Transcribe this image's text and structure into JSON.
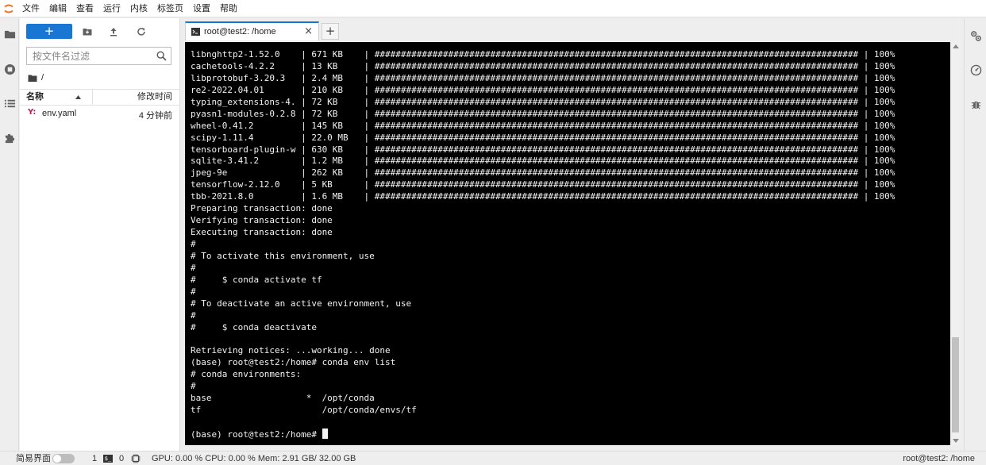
{
  "menu": [
    "文件",
    "编辑",
    "查看",
    "运行",
    "内核",
    "标签页",
    "设置",
    "帮助"
  ],
  "file_browser": {
    "new_button_label": "+",
    "search_placeholder": "按文件名过滤",
    "breadcrumb_path": "/",
    "columns": {
      "name": "名称",
      "modified": "修改时间"
    },
    "files": [
      {
        "icon": "Y:",
        "name": "env.yaml",
        "modified": "4 分钟前"
      }
    ]
  },
  "tab": {
    "label": "root@test2: /home",
    "close_glyph": "×",
    "add_glyph": "+"
  },
  "terminal": {
    "lines": [
      "libnghttp2-1.52.0    | 671 KB    | ############################################################################################ | 100%",
      "cachetools-4.2.2     | 13 KB     | ############################################################################################ | 100%",
      "libprotobuf-3.20.3   | 2.4 MB    | ############################################################################################ | 100%",
      "re2-2022.04.01       | 210 KB    | ############################################################################################ | 100%",
      "typing_extensions-4. | 72 KB     | ############################################################################################ | 100%",
      "pyasn1-modules-0.2.8 | 72 KB     | ############################################################################################ | 100%",
      "wheel-0.41.2         | 145 KB    | ############################################################################################ | 100%",
      "scipy-1.11.4         | 22.0 MB   | ############################################################################################ | 100%",
      "tensorboard-plugin-w | 630 KB    | ############################################################################################ | 100%",
      "sqlite-3.41.2        | 1.2 MB    | ############################################################################################ | 100%",
      "jpeg-9e              | 262 KB    | ############################################################################################ | 100%",
      "tensorflow-2.12.0    | 5 KB      | ############################################################################################ | 100%",
      "tbb-2021.8.0         | 1.6 MB    | ############################################################################################ | 100%",
      "Preparing transaction: done",
      "Verifying transaction: done",
      "Executing transaction: done",
      "#",
      "# To activate this environment, use",
      "#",
      "#     $ conda activate tf",
      "#",
      "# To deactivate an active environment, use",
      "#",
      "#     $ conda deactivate",
      "",
      "Retrieving notices: ...working... done",
      "(base) root@test2:/home# conda env list",
      "# conda environments:",
      "#",
      "base                  *  /opt/conda",
      "tf                       /opt/conda/envs/tf",
      "",
      "(base) root@test2:/home# "
    ]
  },
  "status": {
    "simple_mode_label": "简易界面",
    "terminal_count": "1",
    "terminal_icon_glyph": "$_",
    "kernel_count": "0",
    "resources": "GPU: 0.00 % CPU: 0.00 % Mem: 2.91 GB/ 32.00 GB",
    "right_text": "root@test2: /home"
  },
  "icons": {
    "logo": "jupyter-logo-icon",
    "activity": [
      "folder-icon",
      "running-stop-icon",
      "table-of-contents-icon",
      "extension-puzzle-icon"
    ],
    "right": [
      "property-inspector-gears-icon",
      "debugger-gauge-icon",
      "bug-icon"
    ]
  },
  "colors": {
    "accent": "#1976d2",
    "terminal_bg": "#000000",
    "terminal_fg": "#f2f2f2",
    "logo": "#f37626",
    "yaml": "#c2185b"
  }
}
